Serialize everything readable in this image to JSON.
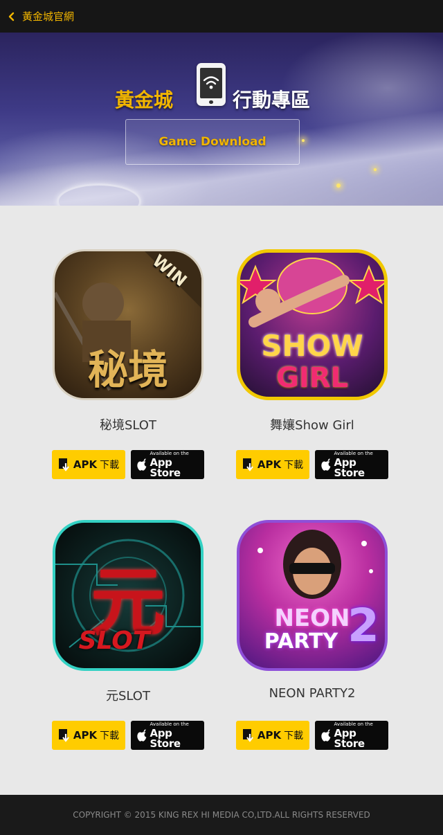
{
  "topbar": {
    "back_label": "黃金城官網"
  },
  "hero": {
    "title_left": "黃金城",
    "title_right": "行動專區",
    "download_button": "Game Download"
  },
  "games": [
    {
      "name": "秘境SLOT",
      "icon_text": "秘境",
      "icon_badge": "WIN",
      "apk_label": "APK",
      "apk_suffix": "下載",
      "store_small": "Available on the",
      "store_big": "App Store"
    },
    {
      "name": "舞孃Show Girl",
      "icon_text": "SHOW",
      "icon_text2": "GIRL",
      "apk_label": "APK",
      "apk_suffix": "下載",
      "store_small": "Available on the",
      "store_big": "App Store"
    },
    {
      "name": "元SLOT",
      "icon_text": "元",
      "icon_text2": "SLOT",
      "apk_label": "APK",
      "apk_suffix": "下載",
      "store_small": "Available on the",
      "store_big": "App Store"
    },
    {
      "name": "NEON PARTY2",
      "icon_text": "NEON",
      "icon_text2": "PARTY",
      "icon_text3": "2",
      "apk_label": "APK",
      "apk_suffix": "下載",
      "store_small": "Available on the",
      "store_big": "App Store"
    }
  ],
  "footer": {
    "copyright": "COPYRIGHT © 2015 KING REX HI MEDIA CO,LTD.ALL RIGHTS RESERVED"
  },
  "colors": {
    "accent": "#f1b500",
    "apk_bg": "#ffcc00",
    "store_bg": "#0a0a0a",
    "page_bg": "#e8e8e8"
  }
}
